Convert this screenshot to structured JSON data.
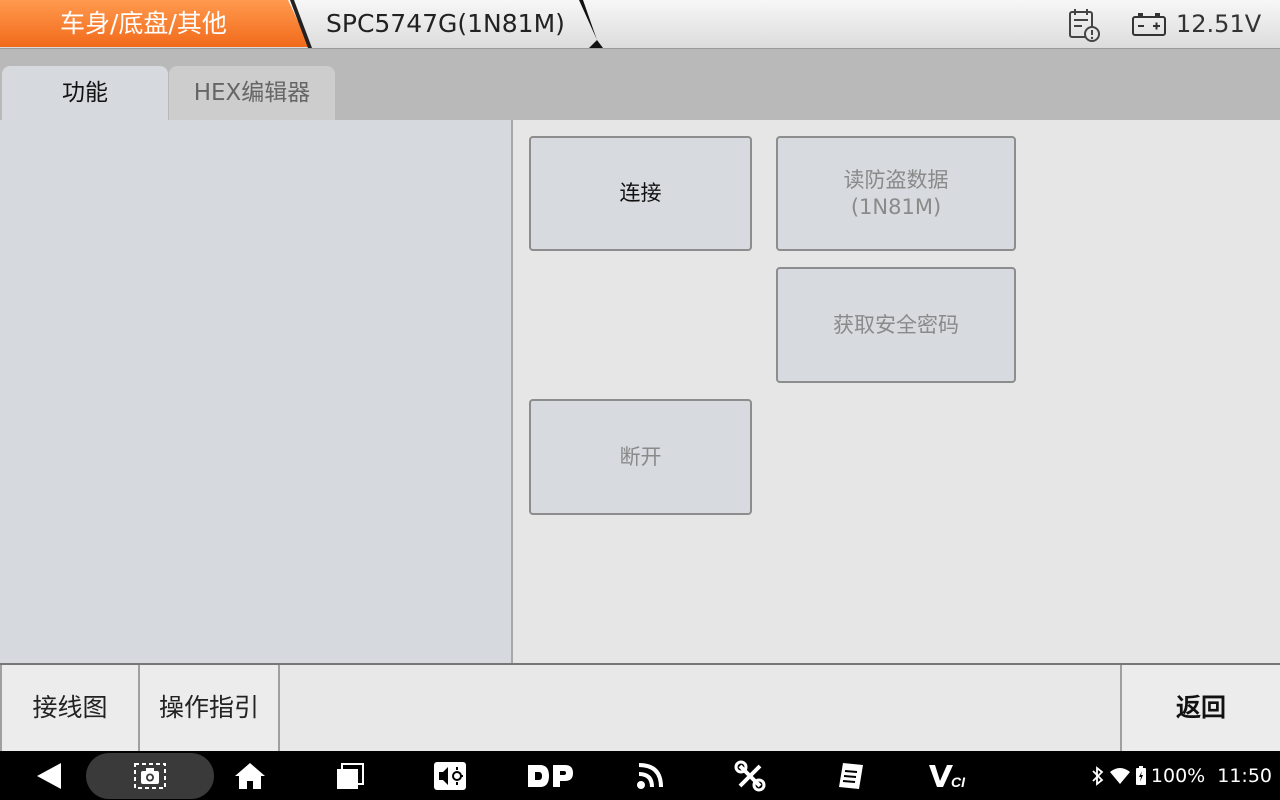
{
  "header": {
    "breadcrumb": [
      "车身/底盘/其他",
      "SPC5747G(1N81M)"
    ],
    "voltage": "12.51V",
    "icons": [
      "report-icon",
      "battery-icon"
    ],
    "accent_color": "#f47a2a"
  },
  "tabs": [
    {
      "label": "功能",
      "active": true
    },
    {
      "label": "HEX编辑器",
      "active": false
    }
  ],
  "functions": {
    "connect": {
      "label": "连接",
      "enabled": true
    },
    "read_immo": {
      "label": "读防盗数据\n(1N81M)",
      "enabled": false
    },
    "get_password": {
      "label": "获取安全密码",
      "enabled": false
    },
    "disconnect": {
      "label": "断开",
      "enabled": false
    }
  },
  "toolbar": {
    "wiring_label": "接线图",
    "guide_label": "操作指引",
    "back_label": "返回"
  },
  "navbar": {
    "icons": [
      "back-icon",
      "screenshot-icon",
      "home-icon",
      "recent-apps-icon",
      "brightness-volume-icon",
      "dp-icon",
      "feed-icon",
      "tools-icon",
      "manual-icon",
      "vci-icon"
    ],
    "status": {
      "battery": "100%",
      "time": "11:50"
    }
  }
}
